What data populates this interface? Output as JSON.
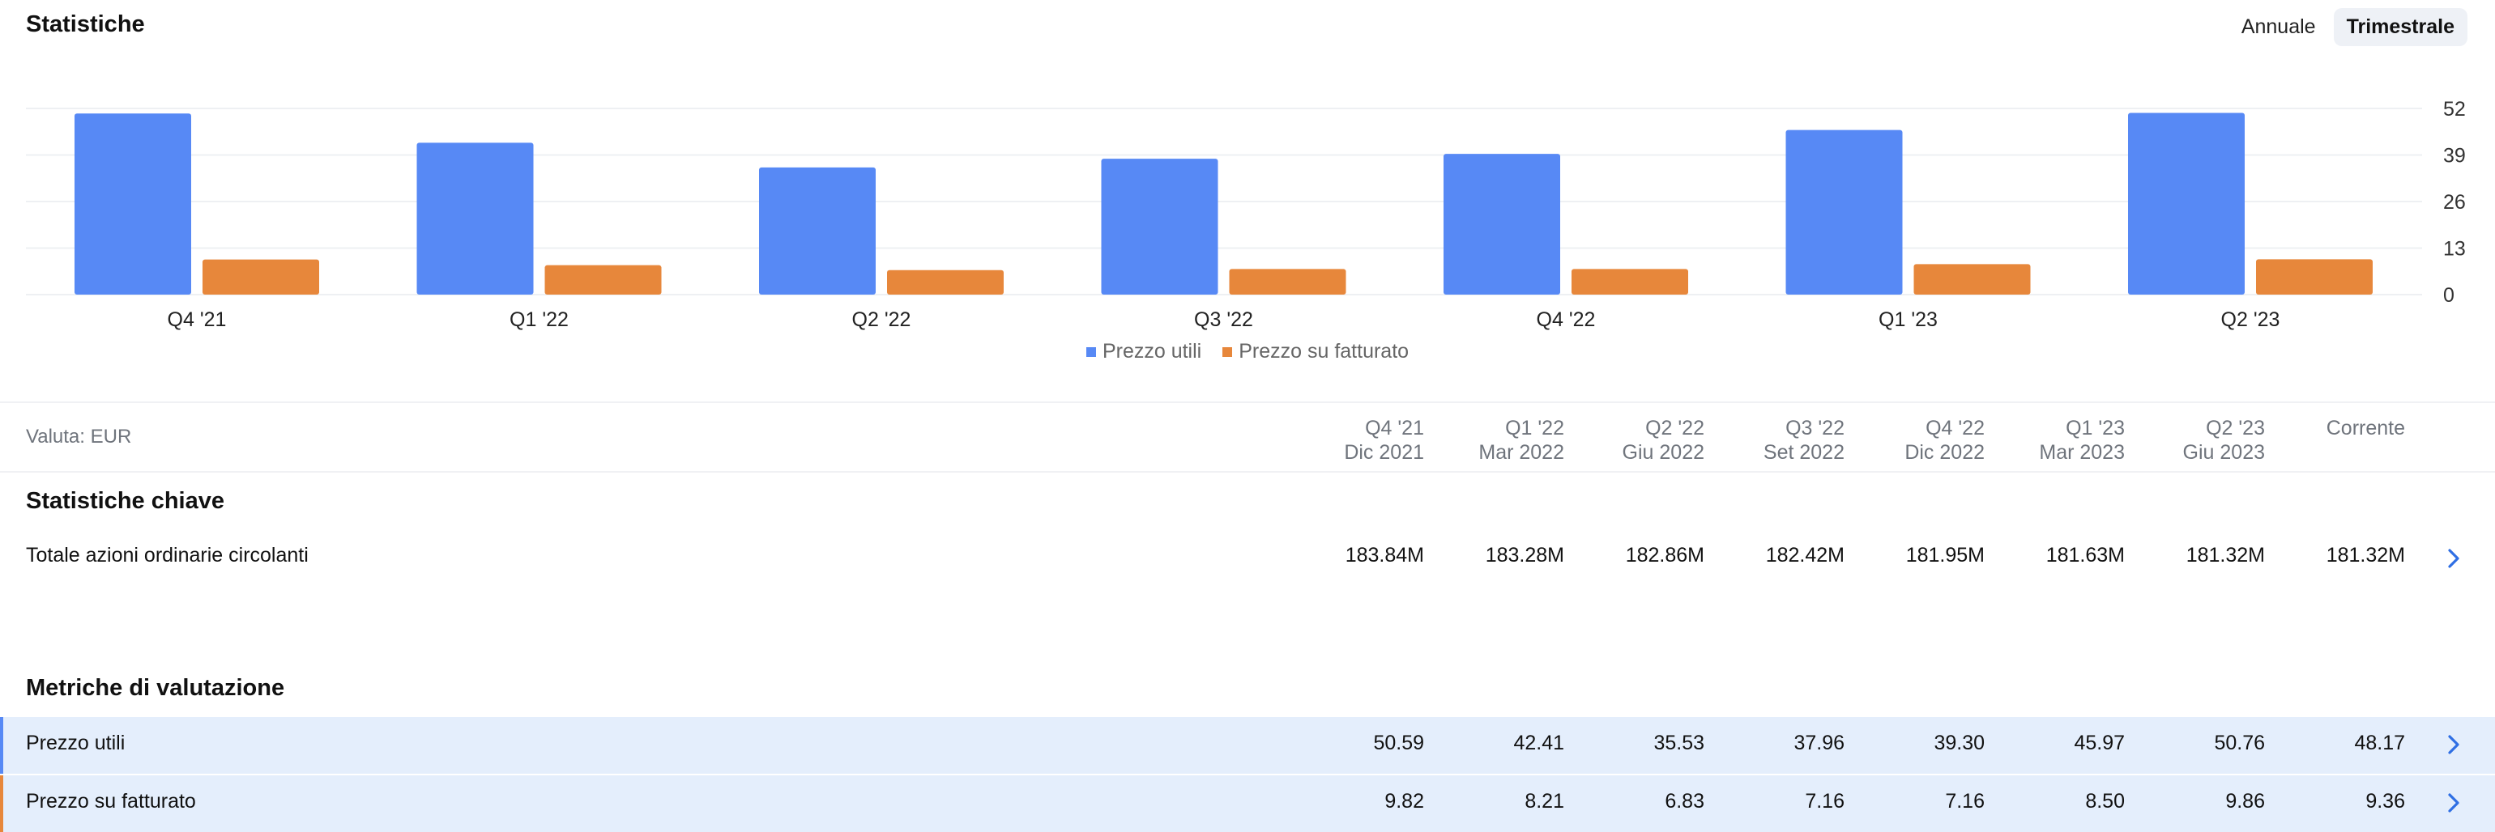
{
  "header": {
    "title": "Statistiche",
    "toggle": {
      "annual_label": "Annuale",
      "quarterly_label": "Trimestrale",
      "active": "Trimestrale"
    }
  },
  "chart_data": {
    "type": "bar",
    "categories": [
      "Q4 '21",
      "Q1 '22",
      "Q2 '22",
      "Q3 '22",
      "Q4 '22",
      "Q1 '23",
      "Q2 '23"
    ],
    "series": [
      {
        "name": "Prezzo utili",
        "color": "#5789f5",
        "values": [
          50.59,
          42.41,
          35.53,
          37.96,
          39.3,
          45.97,
          50.76
        ]
      },
      {
        "name": "Prezzo su fatturato",
        "color": "#e7873b",
        "values": [
          9.82,
          8.21,
          6.83,
          7.16,
          7.16,
          8.5,
          9.86
        ]
      }
    ],
    "yticks": [
      "52",
      "39",
      "26",
      "13",
      "0"
    ],
    "ylim": [
      0,
      52
    ],
    "grid": true,
    "legend": "bottom-center",
    "axis_side": "right"
  },
  "table": {
    "currency_label": "Valuta: EUR",
    "columns": [
      {
        "q": "Q4 '21",
        "date": "Dic 2021"
      },
      {
        "q": "Q1 '22",
        "date": "Mar 2022"
      },
      {
        "q": "Q2 '22",
        "date": "Giu 2022"
      },
      {
        "q": "Q3 '22",
        "date": "Set 2022"
      },
      {
        "q": "Q4 '22",
        "date": "Dic 2022"
      },
      {
        "q": "Q1 '23",
        "date": "Mar 2023"
      },
      {
        "q": "Q2 '23",
        "date": "Giu 2023"
      },
      {
        "q": "Corrente",
        "date": ""
      }
    ],
    "key_stats": {
      "title": "Statistiche chiave",
      "rows": [
        {
          "label": "Totale azioni ordinarie circolanti",
          "values": [
            "183.84M",
            "183.28M",
            "182.86M",
            "182.42M",
            "181.95M",
            "181.63M",
            "181.32M",
            "181.32M"
          ]
        }
      ]
    },
    "valuation": {
      "title": "Metriche di valutazione",
      "rows": [
        {
          "label": "Prezzo utili",
          "accent": "#5789f5",
          "values": [
            "50.59",
            "42.41",
            "35.53",
            "37.96",
            "39.30",
            "45.97",
            "50.76",
            "48.17"
          ]
        },
        {
          "label": "Prezzo su fatturato",
          "accent": "#e7873b",
          "values": [
            "9.82",
            "8.21",
            "6.83",
            "7.16",
            "7.16",
            "8.50",
            "9.86",
            "9.36"
          ]
        }
      ]
    }
  }
}
